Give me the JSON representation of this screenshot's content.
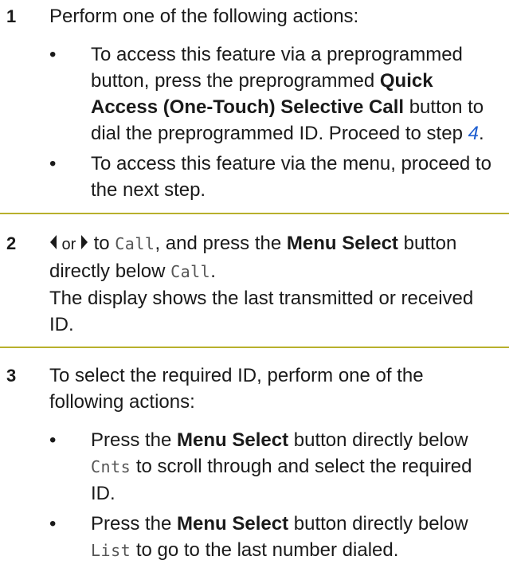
{
  "step1": {
    "number": "1",
    "intro": "Perform one of the following actions:",
    "bullet1": {
      "text1": "To access this feature via a preprogrammed button, press the preprogrammed ",
      "bold": "Quick Access (One-Touch) Selective Call",
      "text2": " button to dial the preprogrammed ID. Proceed to step ",
      "link": "4",
      "text3": "."
    },
    "bullet2": "To access this feature via the menu, proceed to the next step."
  },
  "step2": {
    "number": "2",
    "or": " or ",
    "to": " to ",
    "call_label": "Call",
    "text_after_call": ", and press the ",
    "bold": "Menu Select",
    "text_after_bold": " button directly below ",
    "call_label2": "Call",
    "period": ".",
    "display_text": "The display shows the last transmitted or received ID."
  },
  "step3": {
    "number": "3",
    "intro": "To select the required ID, perform one of the following actions:",
    "bullet1": {
      "text1": "Press the ",
      "bold": "Menu Select",
      "text2": " button directly below ",
      "mono": "Cnts",
      "text3": " to scroll through and select the required ID."
    },
    "bullet2": {
      "text1": "Press the ",
      "bold": "Menu Select",
      "text2": " button directly below ",
      "mono": "List",
      "text3": " to go to the last number dialed."
    }
  },
  "colors": {
    "rule": "#b8b02c",
    "link": "#1f5fd0"
  },
  "icons": [
    "left-arrow-icon",
    "right-arrow-icon",
    "bullet-icon"
  ]
}
